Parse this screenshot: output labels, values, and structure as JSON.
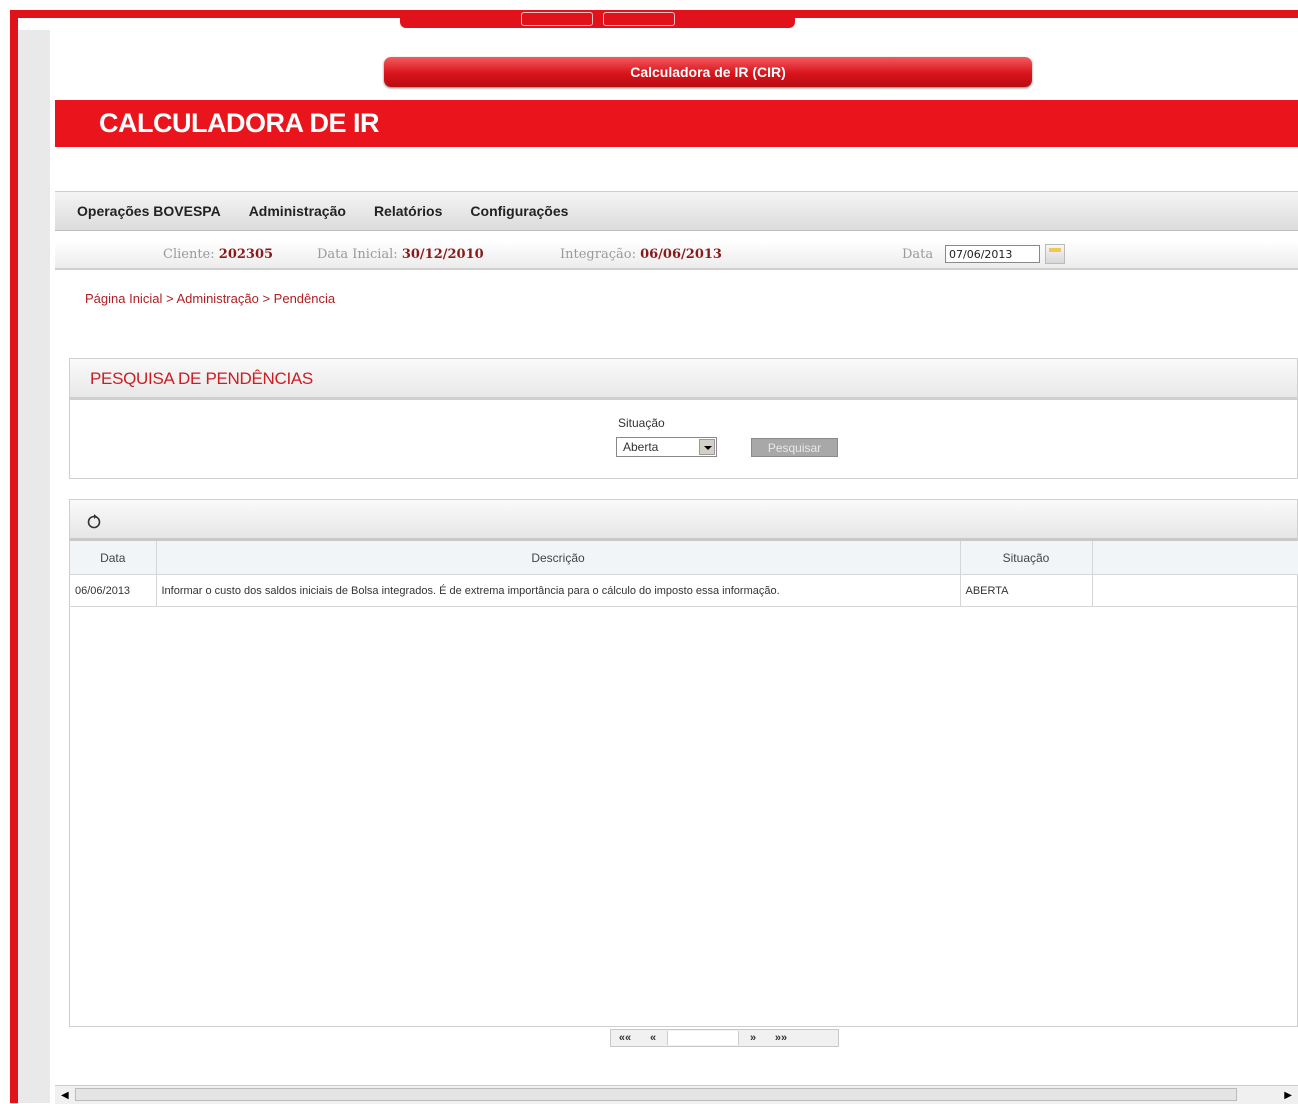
{
  "app": {
    "tab_title": "Calculadora de IR (CIR)",
    "banner_title": "CALCULADORA DE IR"
  },
  "menu": [
    "Operações BOVESPA",
    "Administração",
    "Relatórios",
    "Configurações"
  ],
  "info": {
    "cliente_label": "Cliente:",
    "cliente_value": "202305",
    "data_inicial_label": "Data Inicial:",
    "data_inicial_value": "30/12/2010",
    "integracao_label": "Integração:",
    "integracao_value": "06/06/2013",
    "data_label": "Data",
    "data_value": "07/06/2013"
  },
  "breadcrumb": [
    "Página Inicial",
    "Administração",
    "Pendência"
  ],
  "search": {
    "title": "PESQUISA DE PENDÊNCIAS",
    "situacao_label": "Situação",
    "situacao_value": "Aberta",
    "button_label": "Pesquisar"
  },
  "table": {
    "headers": [
      "Data",
      "Descrição",
      "Situação"
    ],
    "rows": [
      [
        "06/06/2013",
        "Informar o custo dos saldos iniciais de Bolsa integrados. É de extrema importância para o cálculo do imposto essa informação.",
        "ABERTA"
      ]
    ]
  },
  "pager": {
    "first": "««",
    "prev": "«",
    "next": "»",
    "last": "»»"
  },
  "colors": {
    "brand_red": "#e2121c",
    "link_red": "#b01e22"
  }
}
